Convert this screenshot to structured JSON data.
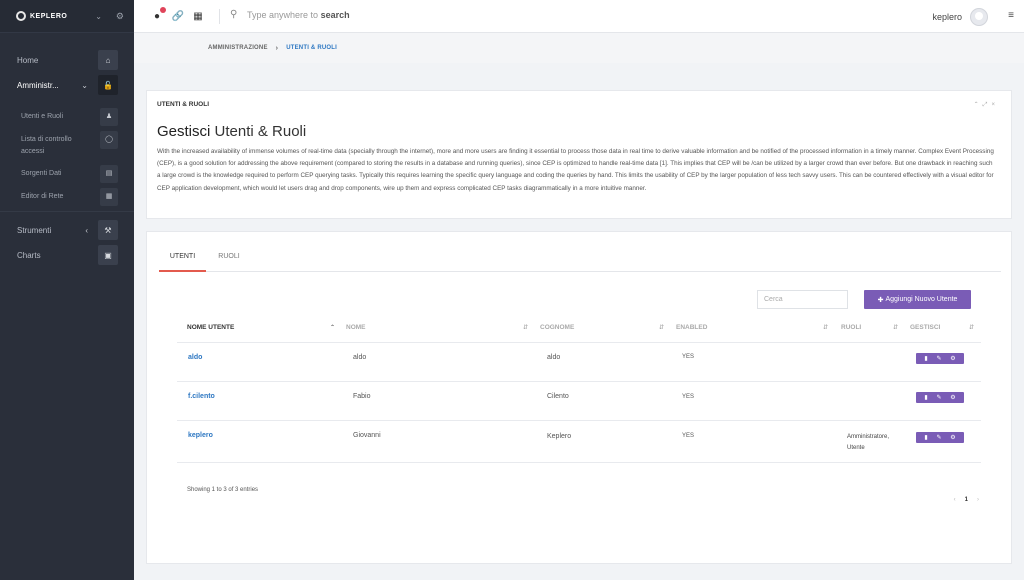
{
  "sidebar": {
    "brand": "KEPLERO",
    "items": [
      {
        "label": "Home",
        "icon": "home-icon"
      },
      {
        "label": "Amministr...",
        "icon": "lock-icon"
      },
      {
        "label": "Strumenti",
        "icon": "wrench-icon"
      },
      {
        "label": "Charts",
        "icon": "image-icon"
      }
    ],
    "subitems": [
      {
        "label": "Utenti e Ruoli",
        "icon": "users-icon"
      },
      {
        "label": "Lista di controllo accessi",
        "icon": "shield-icon"
      },
      {
        "label": "Sorgenti Dati",
        "icon": "database-icon"
      },
      {
        "label": "Editor di Rete",
        "icon": "sitemap-icon"
      }
    ]
  },
  "topbar": {
    "search_prefix": "Type anywhere to",
    "search_bold": "search",
    "username": "keplero"
  },
  "breadcrumb": {
    "parent": "AMMINISTRAZIONE",
    "current": "UTENTI & RUOLI"
  },
  "intro": {
    "header": "UTENTI & RUOLI",
    "title_strong": "Gestisci",
    "title_rest": "Utenti & Ruoli",
    "description": "With the increased availability of immense volumes of real-time data (specially through the internet), more and more users are finding it essential to process those data in real time to derive valuable information and be notified of the processed information in a timely manner. Complex Event Processing (CEP), is a good solution for addressing the above requirement (compared to storing the results in a database and running queries), since CEP is optimized to handle real-time data [1]. This implies that CEP will be /can be utilized by a larger crowd than ever before. But one drawback in reaching such a large crowd is the knowledge required to perform CEP querying tasks. Typically this requires learning the specific query language and coding the queries by hand. This limits the usability of CEP by the larger population of less tech savvy users. This can be countered effectively with a visual editor for CEP application development, which would let users drag and drop components, wire up them and express complicated CEP tasks diagrammatically in a more intuitive manner."
  },
  "users": {
    "tabs": [
      "UTENTI",
      "RUOLI"
    ],
    "search_placeholder": "Cerca",
    "add_button": "Aggiungi Nuovo Utente",
    "columns": [
      "NOME UTENTE",
      "NOME",
      "COGNOME",
      "ENABLED",
      "RUOLI",
      "GESTISCI"
    ],
    "rows": [
      {
        "username": "aldo",
        "nome": "aldo",
        "cognome": "aldo",
        "enabled": "YES",
        "ruoli_1": "",
        "ruoli_2": ""
      },
      {
        "username": "f.cilento",
        "nome": "Fabio",
        "cognome": "Cilento",
        "enabled": "YES",
        "ruoli_1": "",
        "ruoli_2": ""
      },
      {
        "username": "keplero",
        "nome": "Giovanni",
        "cognome": "Keplero",
        "enabled": "YES",
        "ruoli_1": "Amministratore,",
        "ruoli_2": "Utente"
      }
    ],
    "info": "Showing 1 to 3 of 3 entries",
    "page": "1"
  },
  "colors": {
    "accent": "#7a5cb6",
    "link": "#2d77c2",
    "tab_active": "#e35a4d",
    "sidebar": "#2a2f3a"
  }
}
